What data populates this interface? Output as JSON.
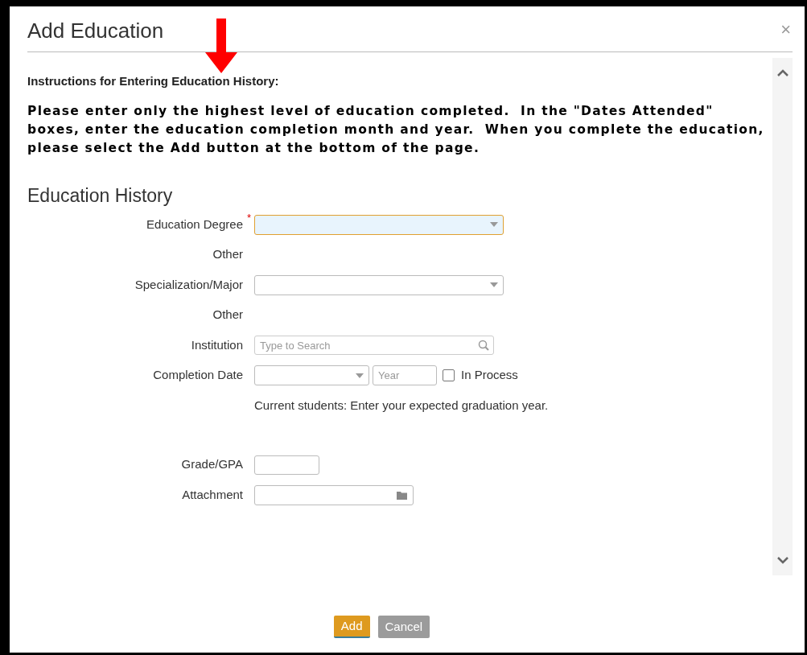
{
  "dialog": {
    "title": "Add Education",
    "close": "×"
  },
  "instructions": {
    "heading": "Instructions for Entering Education History:",
    "body": "Please enter only the highest level of education completed.  In the \"Dates Attended\" boxes, enter the education completion month and year.  When you complete the education, please select the Add button at the bottom of the page."
  },
  "section_title": "Education History",
  "fields": [
    {
      "kind": "select",
      "label": "Education Degree",
      "required_mark": "*",
      "focused": true
    },
    {
      "kind": "text",
      "label": "Other"
    },
    {
      "kind": "select",
      "label": "Specialization/Major",
      "focused": false
    },
    {
      "kind": "text",
      "label": "Other"
    },
    {
      "kind": "search",
      "label": "Institution",
      "placeholder": "Type to Search"
    },
    {
      "kind": "date",
      "label": "Completion Date",
      "year_placeholder": "Year",
      "checkbox_label": "In Process",
      "checked": false
    },
    {
      "kind": "note",
      "text": "Current students: Enter your expected graduation year."
    },
    {
      "kind": "short",
      "label": "Grade/GPA"
    },
    {
      "kind": "file",
      "label": "Attachment"
    }
  ],
  "buttons": [
    {
      "kind": "primary",
      "label": "Add"
    },
    {
      "kind": "secondary",
      "label": "Cancel"
    }
  ]
}
